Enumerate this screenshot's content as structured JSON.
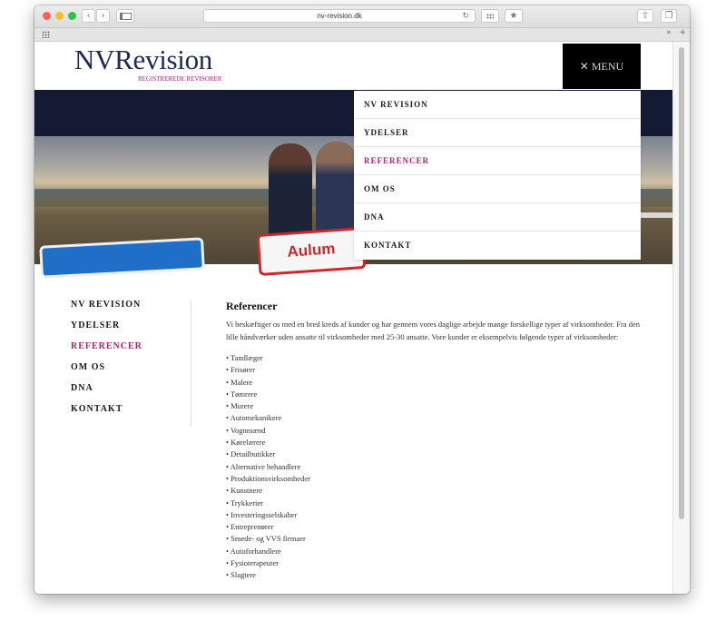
{
  "browser": {
    "url": "nv-revision.dk",
    "back_glyph": "‹",
    "forward_glyph": "›",
    "overflow_glyph": "»",
    "add_glyph": "+",
    "colors": {
      "close": "#fc5f57",
      "minimize": "#fdbc2e",
      "maximize": "#28c840"
    }
  },
  "header": {
    "logo_name": "NVRevision",
    "logo_tagline": "REGISTREREDE REVISORER",
    "menu_button": "✕  MENU"
  },
  "hero": {
    "sign_text": "Aulum"
  },
  "dropdown": {
    "items": [
      {
        "label": "NV REVISION"
      },
      {
        "label": "YDELSER"
      },
      {
        "label": "REFERENCER"
      },
      {
        "label": "OM OS"
      },
      {
        "label": "DNA"
      },
      {
        "label": "KONTAKT"
      }
    ],
    "active_index": 2
  },
  "sidebar": {
    "items": [
      {
        "label": "NV REVISION"
      },
      {
        "label": "YDELSER"
      },
      {
        "label": "REFERENCER"
      },
      {
        "label": "OM OS"
      },
      {
        "label": "DNA"
      },
      {
        "label": "KONTAKT"
      }
    ],
    "active_index": 2
  },
  "content": {
    "title": "Referencer",
    "intro": "Vi beskæftiger os med en bred kreds af kunder og har gennem vores daglige arbejde mange forskellige typer af virksomheder. Fra den lille håndværker uden ansatte til virksomheder med 25-30 ansatte. Vore kunder er eksempelvis følgende typer af virksomheder:",
    "list": [
      "Tandlæger",
      "Frisører",
      "Malere",
      "Tømrere",
      "Murere",
      "Automekanikere",
      "Vognmænd",
      "Kørelærere",
      "Detailbutikker",
      "Alternative behandlere",
      "Produktionsvirksomheder",
      "Kunstnere",
      "Trykkerier",
      "Investeringsselskaber",
      "Entreprenører",
      "Smede- og VVS firmaer",
      "Autoforhandlere",
      "Fysioterapeuter",
      "Slagtere"
    ]
  },
  "colors": {
    "accent": "#a8266e",
    "navy": "#141a33",
    "logo": "#1e2a55"
  }
}
